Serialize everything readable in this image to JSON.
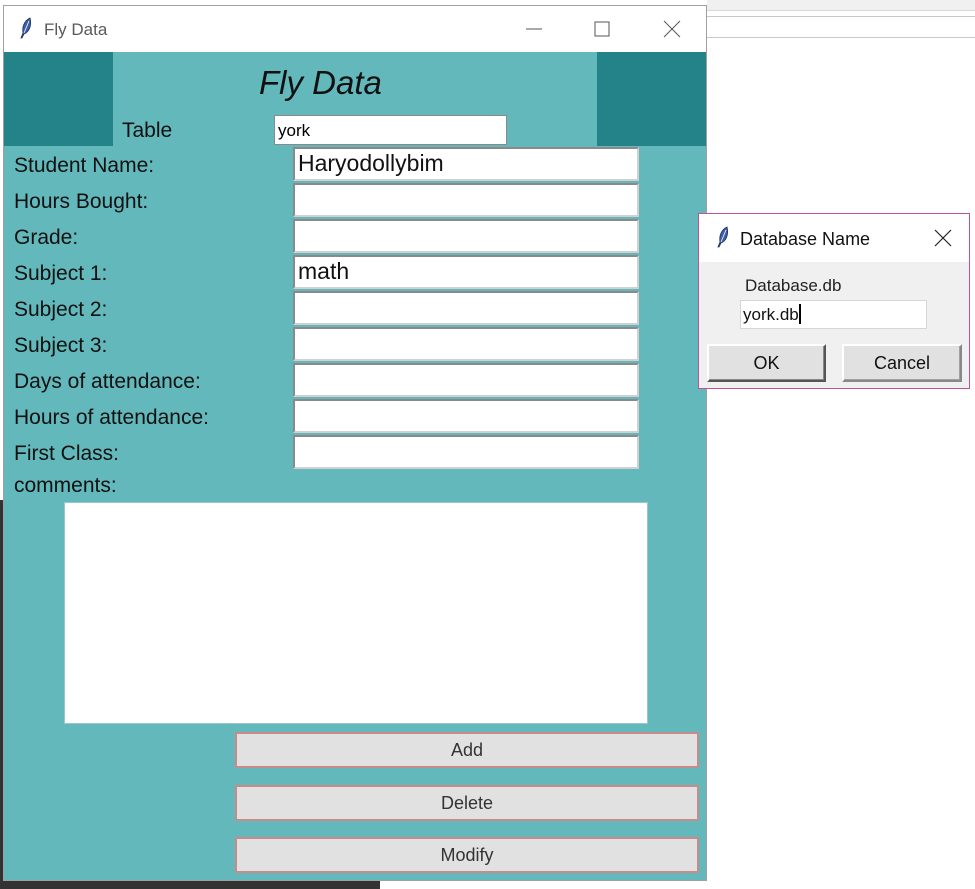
{
  "main_window": {
    "title": "Fly Data",
    "app_title": "Fly Data",
    "table_label": "Table",
    "table_value": "york",
    "fields": [
      {
        "label": "Student Name:",
        "value": "Haryodollybim"
      },
      {
        "label": "Hours Bought:",
        "value": ""
      },
      {
        "label": "Grade:",
        "value": ""
      },
      {
        "label": "Subject 1:",
        "value": "math"
      },
      {
        "label": "Subject 2:",
        "value": ""
      },
      {
        "label": "Subject 3:",
        "value": ""
      },
      {
        "label": "Days of attendance:",
        "value": ""
      },
      {
        "label": "Hours of attendance:",
        "value": ""
      },
      {
        "label": "First Class:",
        "value": ""
      }
    ],
    "comments_label": "comments:",
    "comments_value": "",
    "buttons": {
      "add": "Add",
      "delete": "Delete",
      "modify": "Modify"
    }
  },
  "dialog": {
    "title": "Database Name",
    "label": "Database.db",
    "input_value": "york.db",
    "ok": "OK",
    "cancel": "Cancel"
  },
  "colors": {
    "window_bg": "#62b8bb",
    "header_dark": "#248289",
    "dialog_border": "#c2509b"
  },
  "icons": [
    "feather-icon",
    "minimize-icon",
    "maximize-icon",
    "close-icon"
  ]
}
